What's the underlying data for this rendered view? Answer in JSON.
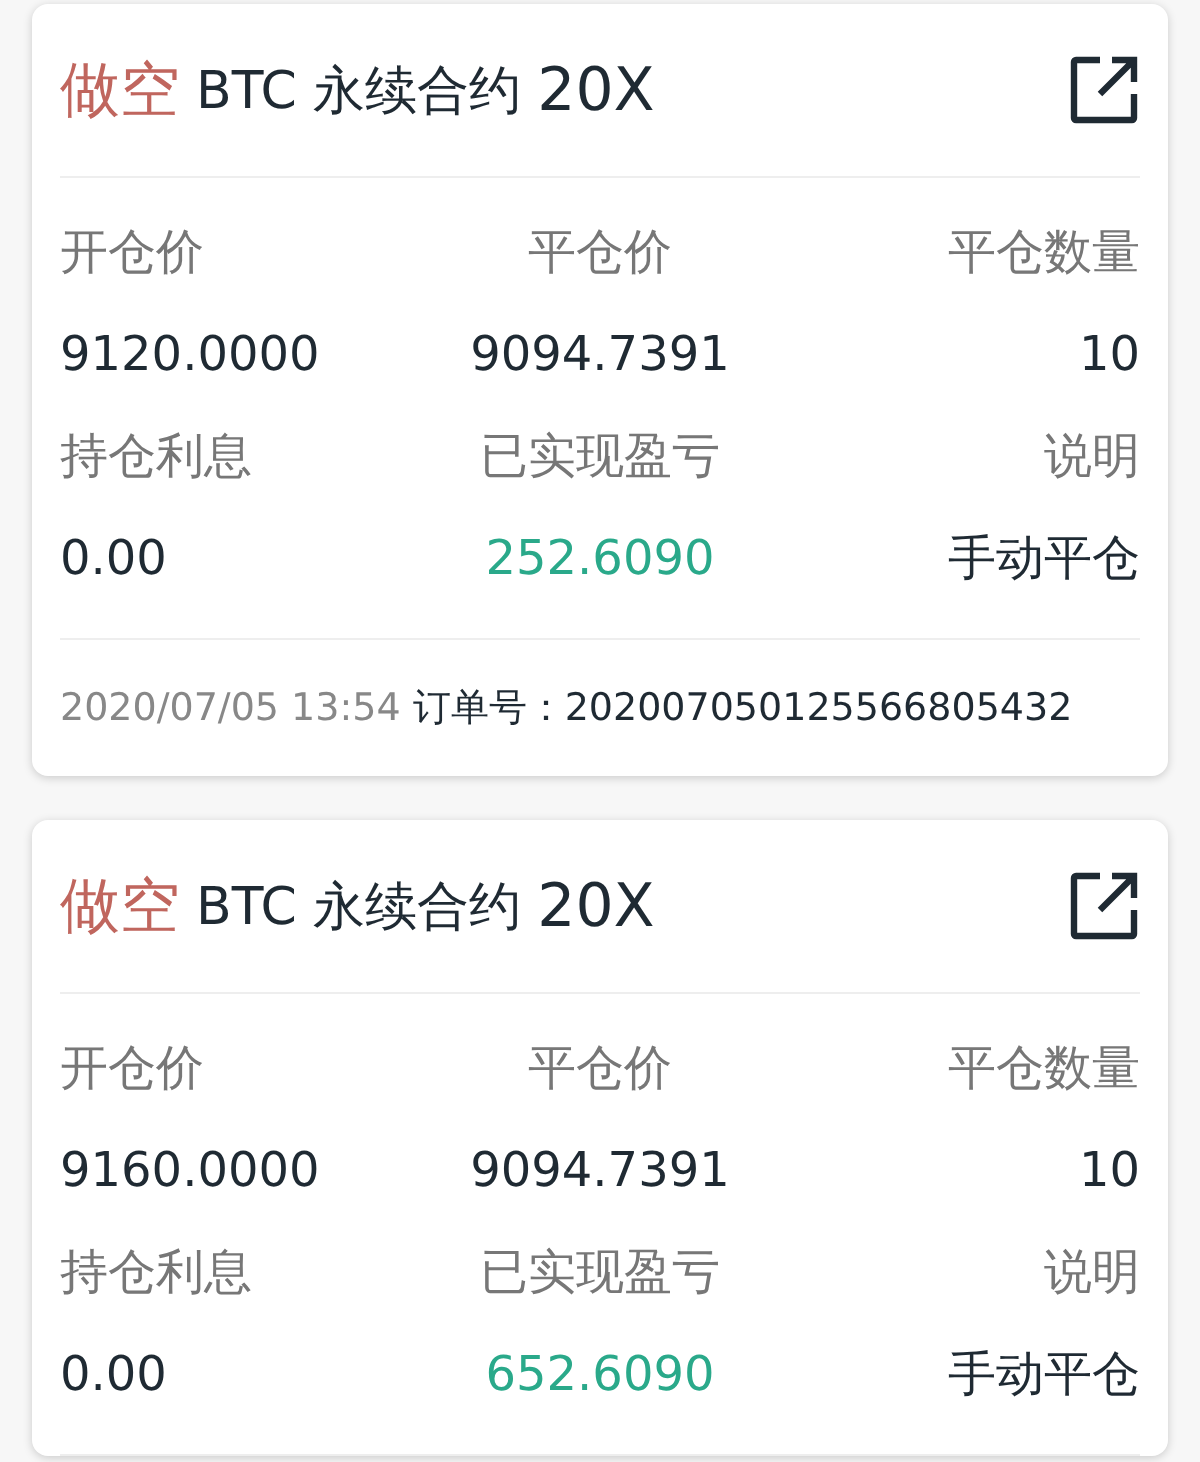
{
  "orders": [
    {
      "side": "做空",
      "symbol": "BTC 永续合约",
      "leverage": "20X",
      "fields": [
        {
          "label": "开仓价",
          "value": "9120.0000",
          "kind": "plain"
        },
        {
          "label": "平仓价",
          "value": "9094.7391",
          "kind": "plain"
        },
        {
          "label": "平仓数量",
          "value": "10",
          "kind": "plain"
        },
        {
          "label": "持仓利息",
          "value": "0.00",
          "kind": "plain"
        },
        {
          "label": "已实现盈亏",
          "value": "252.6090",
          "kind": "profit"
        },
        {
          "label": "说明",
          "value": "手动平仓",
          "kind": "plain"
        }
      ],
      "time": "2020/07/05 13:54",
      "order": "订单号：202007050125566805432"
    },
    {
      "side": "做空",
      "symbol": "BTC 永续合约",
      "leverage": "20X",
      "fields": [
        {
          "label": "开仓价",
          "value": "9160.0000",
          "kind": "plain"
        },
        {
          "label": "平仓价",
          "value": "9094.7391",
          "kind": "plain"
        },
        {
          "label": "平仓数量",
          "value": "10",
          "kind": "plain"
        },
        {
          "label": "持仓利息",
          "value": "0.00",
          "kind": "plain"
        },
        {
          "label": "已实现盈亏",
          "value": "652.6090",
          "kind": "profit"
        },
        {
          "label": "说明",
          "value": "手动平仓",
          "kind": "plain"
        }
      ]
    }
  ]
}
